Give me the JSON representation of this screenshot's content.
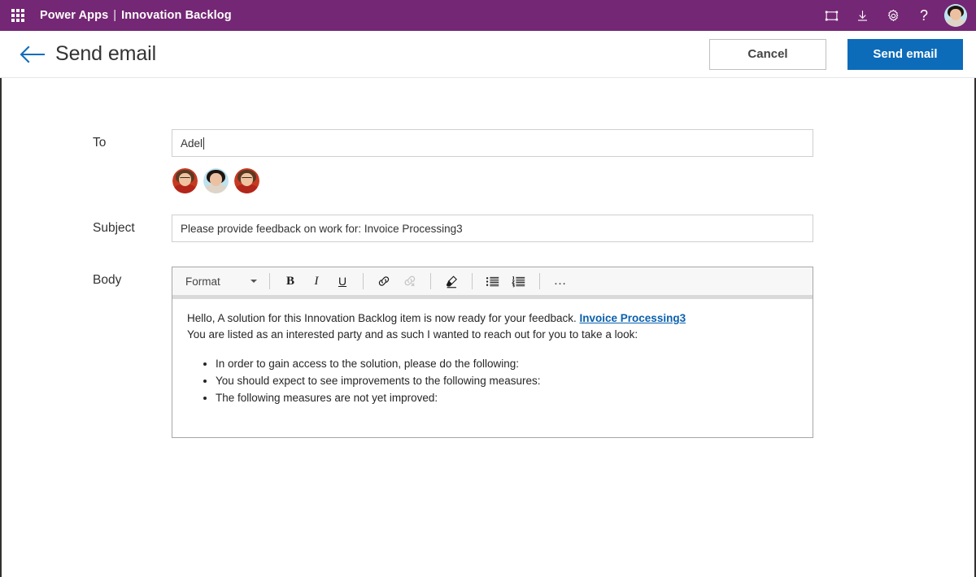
{
  "suite": {
    "waffle_icon": "app-launcher-waffle-icon",
    "brand": "Power Apps",
    "separator": "|",
    "app_name": "Innovation Backlog",
    "actions": [
      {
        "icon": "fit-to-screen-icon",
        "label": "Fit to screen"
      },
      {
        "icon": "download-icon",
        "label": "Download"
      },
      {
        "icon": "gear-icon",
        "label": "Settings"
      },
      {
        "icon": "help-question-icon",
        "label": "Help"
      }
    ],
    "avatar": "user-avatar"
  },
  "command_bar": {
    "back_icon": "back-arrow-icon",
    "title": "Send email",
    "cancel_label": "Cancel",
    "send_label": "Send email"
  },
  "form": {
    "to": {
      "label": "To",
      "value": "Adel",
      "placeholder": "",
      "people": [
        {
          "name": "person-avatar-1",
          "style": "warm"
        },
        {
          "name": "person-avatar-2",
          "style": "cool"
        },
        {
          "name": "person-avatar-3",
          "style": "warm"
        }
      ]
    },
    "subject": {
      "label": "Subject",
      "value": "Please provide feedback on work for: Invoice Processing3",
      "placeholder": ""
    },
    "body": {
      "label": "Body",
      "toolbar": {
        "format_label": "Format",
        "buttons": [
          {
            "name": "bold-button",
            "icon": "bold-icon",
            "label": "B",
            "disabled": false
          },
          {
            "name": "italic-button",
            "icon": "italic-icon",
            "label": "I",
            "disabled": false
          },
          {
            "name": "underline-button",
            "icon": "underline-icon",
            "label": "U",
            "disabled": false
          },
          {
            "name": "insert-link-button",
            "icon": "link-icon",
            "label": "Insert link",
            "disabled": false
          },
          {
            "name": "remove-link-button",
            "icon": "unlink-icon",
            "label": "Remove link",
            "disabled": true
          },
          {
            "name": "clear-format-button",
            "icon": "highlighter-icon",
            "label": "Clear formatting",
            "disabled": false
          },
          {
            "name": "bulleted-list-button",
            "icon": "bulleted-list-icon",
            "label": "Bulleted list",
            "disabled": false
          },
          {
            "name": "numbered-list-button",
            "icon": "numbered-list-icon",
            "label": "Numbered list",
            "disabled": false
          },
          {
            "name": "more-commands-button",
            "icon": "ellipsis-icon",
            "label": "More commands",
            "disabled": false
          }
        ]
      },
      "content": {
        "paragraph1_text": "Hello, A solution for this Innovation Backlog item is now ready for your feedback. ",
        "paragraph1_link": "Invoice Processing3",
        "paragraph2": "You are listed as an interested party and as such I wanted to reach out for you to take a look:",
        "bullets": [
          "In order to gain access to the solution, please do the following:",
          "You should expect to see improvements to the following measures:",
          "The following measures are not yet improved:"
        ]
      }
    }
  },
  "colors": {
    "brand_purple": "#742774",
    "primary_blue": "#0d6cb9",
    "link_blue": "#0a60ad",
    "back_arrow_blue": "#0f6cbd"
  }
}
